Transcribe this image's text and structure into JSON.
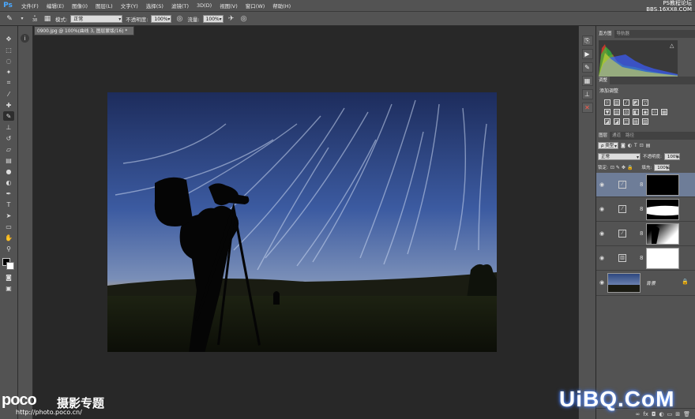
{
  "app": {
    "logo": "Ps"
  },
  "menu": [
    "文件(F)",
    "编辑(E)",
    "图像(I)",
    "图层(L)",
    "文字(Y)",
    "选择(S)",
    "滤镜(T)",
    "3D(D)",
    "视图(V)",
    "窗口(W)",
    "帮助(H)"
  ],
  "watermark_top": {
    "line1": "PS教程论坛",
    "line2": "BBS.16XX8.COM"
  },
  "options": {
    "brush_size": "38",
    "mode_label": "模式:",
    "mode_value": "正常",
    "opacity_label": "不透明度:",
    "opacity_value": "100%",
    "flow_label": "流量:",
    "flow_value": "100%"
  },
  "document": {
    "tab_title": "0900.jpg @ 100%(曲线 3, 图层蒙版/16) *"
  },
  "panels": {
    "histogram_tabs": [
      "直方图",
      "导航器"
    ],
    "adjust_tab": "调整",
    "adjust_title": "添加调整",
    "layers_tabs": [
      "图层",
      "通道",
      "路径"
    ],
    "kind_value": "ρ 类型",
    "blend_value": "正常",
    "opacity_label": "不透明度:",
    "opacity_value": "100%",
    "lock_label": "锁定:",
    "fill_label": "填充:",
    "fill_value": "100%",
    "background_layer_name": "背景"
  },
  "layers": [
    {
      "type": "curves",
      "mask": "black",
      "selected": true
    },
    {
      "type": "curves",
      "mask": "band"
    },
    {
      "type": "curves",
      "mask": "silhouette"
    },
    {
      "type": "levels",
      "mask": "white"
    },
    {
      "type": "background"
    }
  ],
  "watermark_bottom": {
    "poco": "poco",
    "poco_cn": "摄影专题",
    "url": "http://photo.poco.cn/",
    "uibq": "UiBQ.CoM"
  },
  "colors": {
    "accent": "#6e7d98",
    "panel": "#535353",
    "canvas": "#282828"
  }
}
